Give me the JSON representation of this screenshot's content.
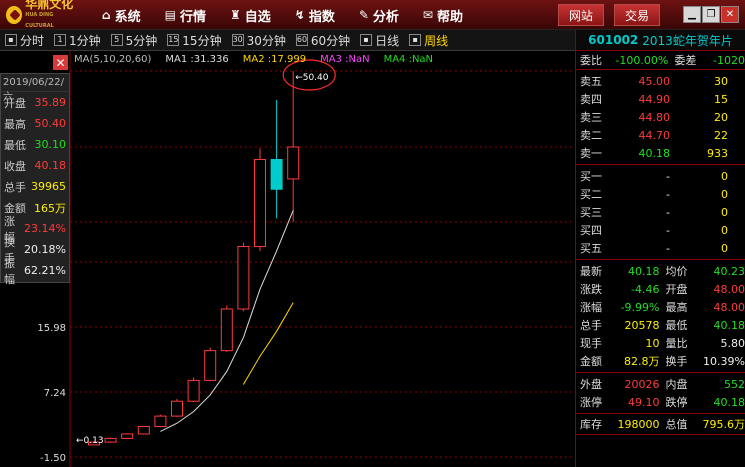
{
  "topbar": {
    "logo_text": "华鼎文化",
    "logo_sub": "HUA DING CULTURAL",
    "menu": [
      {
        "label": "系统",
        "icon": "home-icon"
      },
      {
        "label": "行情",
        "icon": "chart-icon"
      },
      {
        "label": "自选",
        "icon": "basket-icon"
      },
      {
        "label": "指数",
        "icon": "index-icon"
      },
      {
        "label": "分析",
        "icon": "analysis-icon"
      },
      {
        "label": "帮助",
        "icon": "help-icon"
      }
    ],
    "btn_site": "网站",
    "btn_trade": "交易"
  },
  "periods": [
    {
      "label": "分时",
      "key": ""
    },
    {
      "label": "1分钟",
      "key": "1"
    },
    {
      "label": "5分钟",
      "key": "5"
    },
    {
      "label": "15分钟",
      "key": "15"
    },
    {
      "label": "30分钟",
      "key": "30"
    },
    {
      "label": "60分钟",
      "key": "60"
    },
    {
      "label": "日线",
      "key": ""
    },
    {
      "label": "周线",
      "key": ""
    }
  ],
  "active_period": "周线",
  "stock": {
    "code": "601002",
    "name": "2013蛇年贺年片"
  },
  "legend": {
    "ma_label": "MA(5,10,20,60)",
    "ma1": "MA1 :31.336",
    "ma2": "MA2 :17.999",
    "ma3": "MA3 :NaN",
    "ma4": "MA4 :NaN"
  },
  "colors": {
    "ma1": "#dddddd",
    "ma2": "#ffd700",
    "ma3": "#ff44ff",
    "ma4": "#22dd22",
    "up": "#ff3b3b",
    "down": "#00cccc"
  },
  "info": {
    "date": "2019/06/22/六",
    "rows": [
      {
        "label": "开盘",
        "value": "35.89",
        "color": "red"
      },
      {
        "label": "最高",
        "value": "50.40",
        "color": "red"
      },
      {
        "label": "最低",
        "value": "30.10",
        "color": "green"
      },
      {
        "label": "收盘",
        "value": "40.18",
        "color": "red"
      },
      {
        "label": "总手",
        "value": "39965",
        "color": "yellow"
      },
      {
        "label": "金额",
        "value": "165万",
        "color": "yellow"
      },
      {
        "label": "涨幅",
        "value": "23.14%",
        "color": "red"
      },
      {
        "label": "换手",
        "value": "20.18%",
        "color": "white"
      },
      {
        "label": "振幅",
        "value": "62.21%",
        "color": "white"
      }
    ]
  },
  "chart_data": {
    "type": "candlestick",
    "y_ticks": [
      "15.98",
      "7.24",
      "-1.50"
    ],
    "high_marker": "50.40",
    "low_marker": "0.13",
    "candles": [
      {
        "o": 0.13,
        "c": 0.5,
        "h": 0.6,
        "l": 0.13
      },
      {
        "o": 0.5,
        "c": 1.0,
        "h": 1.1,
        "l": 0.4
      },
      {
        "o": 1.0,
        "c": 1.6,
        "h": 1.7,
        "l": 0.9
      },
      {
        "o": 1.6,
        "c": 2.6,
        "h": 2.7,
        "l": 1.5
      },
      {
        "o": 2.6,
        "c": 4.0,
        "h": 4.2,
        "l": 2.5
      },
      {
        "o": 4.0,
        "c": 6.0,
        "h": 6.3,
        "l": 3.9
      },
      {
        "o": 6.0,
        "c": 8.8,
        "h": 9.2,
        "l": 5.9
      },
      {
        "o": 8.8,
        "c": 12.8,
        "h": 13.2,
        "l": 8.7
      },
      {
        "o": 12.8,
        "c": 18.4,
        "h": 18.9,
        "l": 12.6
      },
      {
        "o": 18.4,
        "c": 26.8,
        "h": 27.3,
        "l": 18.1
      },
      {
        "o": 26.8,
        "c": 38.5,
        "h": 40.0,
        "l": 26.2
      },
      {
        "o": 38.5,
        "c": 34.5,
        "h": 46.5,
        "l": 30.6
      },
      {
        "o": 35.89,
        "c": 40.18,
        "h": 50.4,
        "l": 30.1
      }
    ]
  },
  "quote": {
    "wei": {
      "l1": "委比",
      "v1": "-100.00%",
      "l2": "委差",
      "v2": "-1020"
    },
    "asks": [
      {
        "label": "卖五",
        "price": "45.00",
        "vol": "30"
      },
      {
        "label": "卖四",
        "price": "44.90",
        "vol": "15"
      },
      {
        "label": "卖三",
        "price": "44.80",
        "vol": "20"
      },
      {
        "label": "卖二",
        "price": "44.70",
        "vol": "22"
      },
      {
        "label": "卖一",
        "price": "40.18",
        "vol": "933"
      }
    ],
    "bids": [
      {
        "label": "买一",
        "price": "-",
        "vol": "0"
      },
      {
        "label": "买二",
        "price": "-",
        "vol": "0"
      },
      {
        "label": "买三",
        "price": "-",
        "vol": "0"
      },
      {
        "label": "买四",
        "price": "-",
        "vol": "0"
      },
      {
        "label": "买五",
        "price": "-",
        "vol": "0"
      }
    ],
    "stats": [
      {
        "k": "最新",
        "v": "40.18",
        "vc": "green",
        "k2": "均价",
        "v2": "40.23",
        "v2c": "green"
      },
      {
        "k": "涨跌",
        "v": "-4.46",
        "vc": "green",
        "k2": "开盘",
        "v2": "48.00",
        "v2c": "red"
      },
      {
        "k": "涨幅",
        "v": "-9.99%",
        "vc": "green",
        "k2": "最高",
        "v2": "48.00",
        "v2c": "red"
      },
      {
        "k": "总手",
        "v": "20578",
        "vc": "yellow",
        "k2": "最低",
        "v2": "40.18",
        "v2c": "green"
      },
      {
        "k": "现手",
        "v": "10",
        "vc": "yellow",
        "k2": "量比",
        "v2": "5.80",
        "v2c": "white"
      },
      {
        "k": "金额",
        "v": "82.8万",
        "vc": "yellow",
        "k2": "换手",
        "v2": "10.39%",
        "v2c": "white"
      }
    ],
    "stats2": [
      {
        "k": "外盘",
        "v": "20026",
        "vc": "red",
        "k2": "内盘",
        "v2": "552",
        "v2c": "green"
      },
      {
        "k": "涨停",
        "v": "49.10",
        "vc": "red",
        "k2": "跌停",
        "v2": "40.18",
        "v2c": "green"
      }
    ],
    "stats3": [
      {
        "k": "库存",
        "v": "198000",
        "vc": "yellow",
        "k2": "总值",
        "v2": "795.6万",
        "v2c": "yellow"
      }
    ]
  }
}
